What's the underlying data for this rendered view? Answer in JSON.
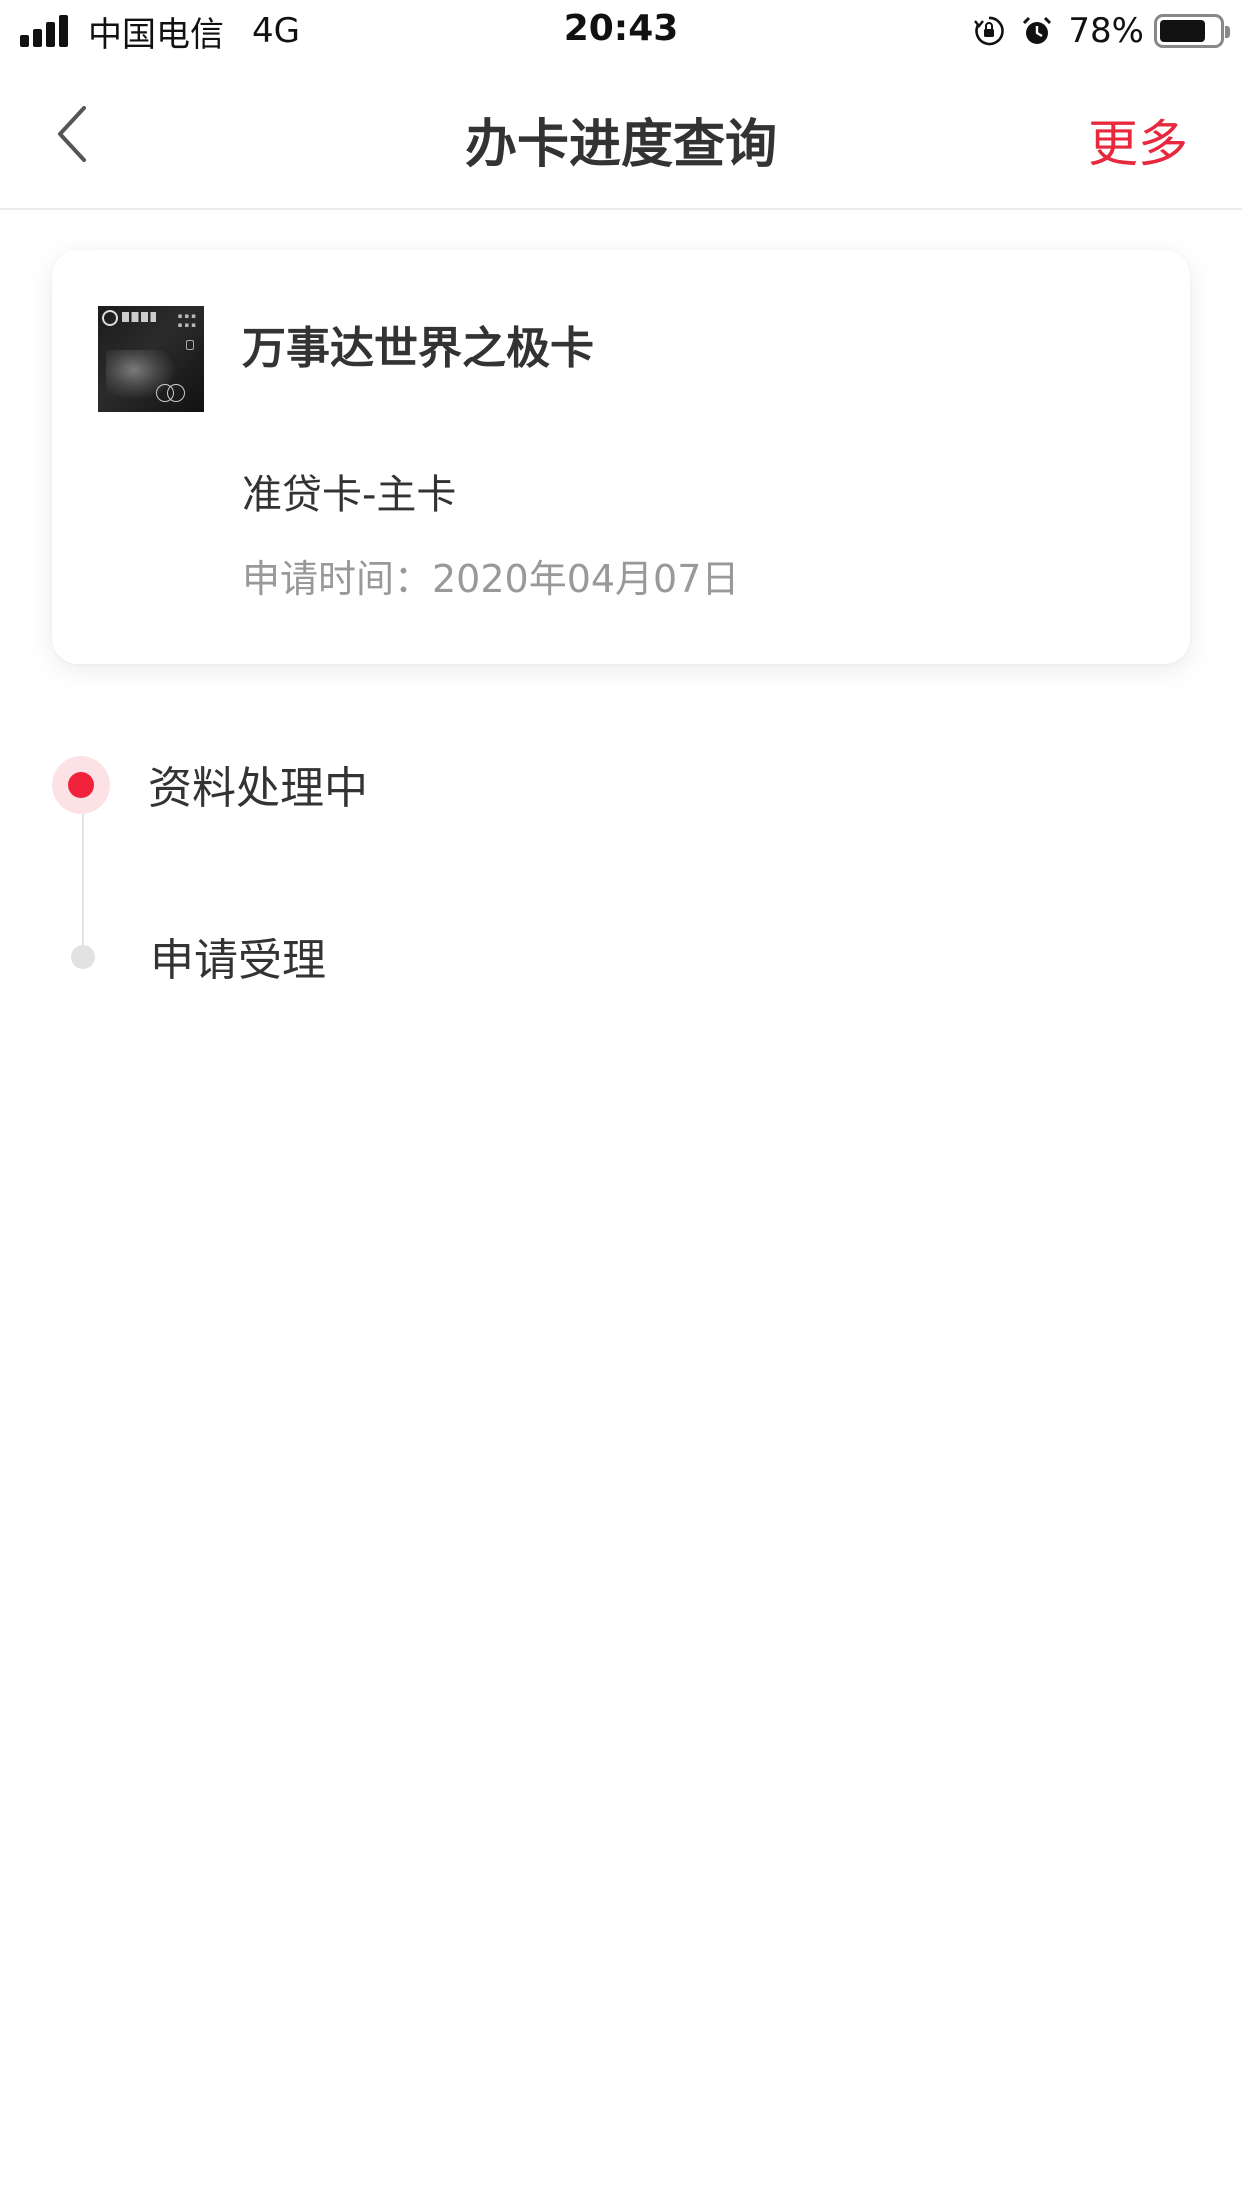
{
  "status_bar": {
    "carrier": "中国电信",
    "network": "4G",
    "time": "20:43",
    "battery_percent": "78%",
    "battery_level": 0.78
  },
  "nav": {
    "title": "办卡进度查询",
    "more_label": "更多",
    "accent_color": "#e8283c"
  },
  "card": {
    "name": "万事达世界之极卡",
    "type": "准贷卡-主卡",
    "apply_date": "申请时间：2020年04月07日"
  },
  "progress": {
    "steps": [
      {
        "label": "资料处理中",
        "active": true
      },
      {
        "label": "申请受理",
        "active": false
      }
    ]
  }
}
